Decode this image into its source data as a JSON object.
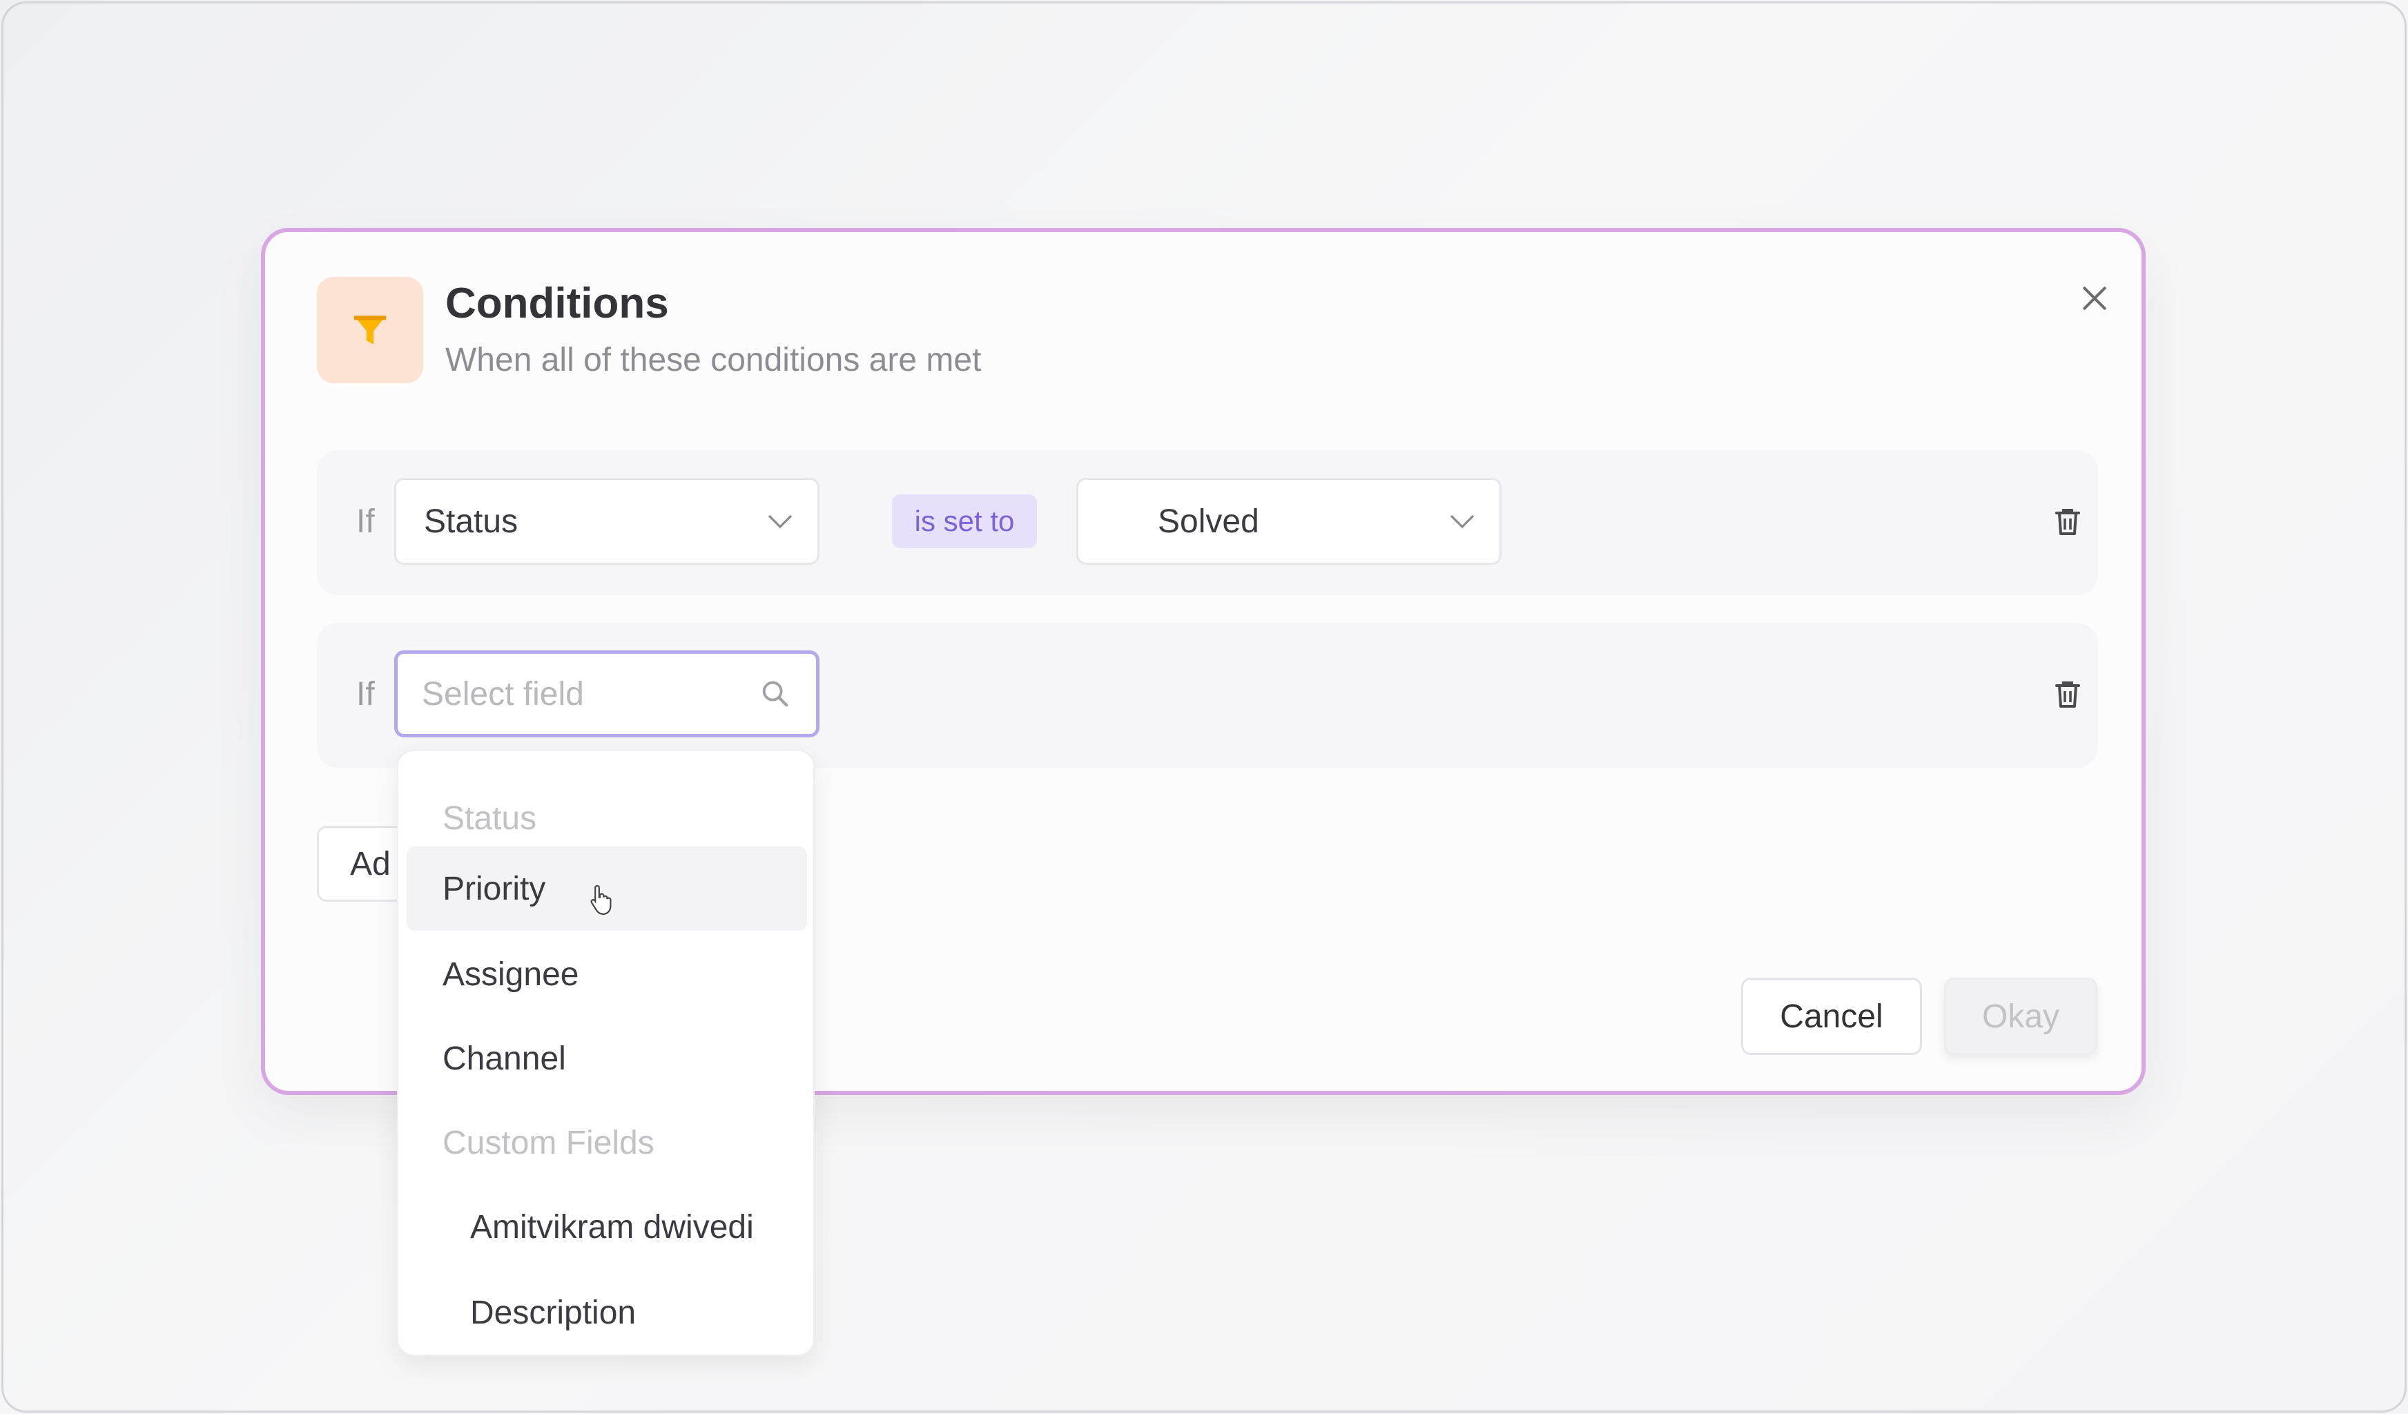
{
  "modal": {
    "title": "Conditions",
    "subtitle": "When all of these conditions are met",
    "icon": "filter-icon",
    "accent_color": "#ffb400",
    "border_color": "#d8a6e2"
  },
  "conditions": [
    {
      "if_label": "If",
      "field": "Status",
      "operator": "is set to",
      "value": "Solved"
    },
    {
      "if_label": "If",
      "field_placeholder": "Select field",
      "field_value": ""
    }
  ],
  "add_button_label": "Ad",
  "dropdown": {
    "items": [
      {
        "label": "Status",
        "kind": "header"
      },
      {
        "label": "Priority",
        "kind": "option",
        "hovered": true
      },
      {
        "label": "Assignee",
        "kind": "option"
      },
      {
        "label": "Channel",
        "kind": "option"
      },
      {
        "label": "Custom Fields",
        "kind": "header"
      },
      {
        "label": "Amitvikram dwivedi",
        "kind": "sub-option"
      },
      {
        "label": "Description",
        "kind": "sub-option"
      }
    ]
  },
  "footer": {
    "cancel_label": "Cancel",
    "okay_label": "Okay"
  }
}
